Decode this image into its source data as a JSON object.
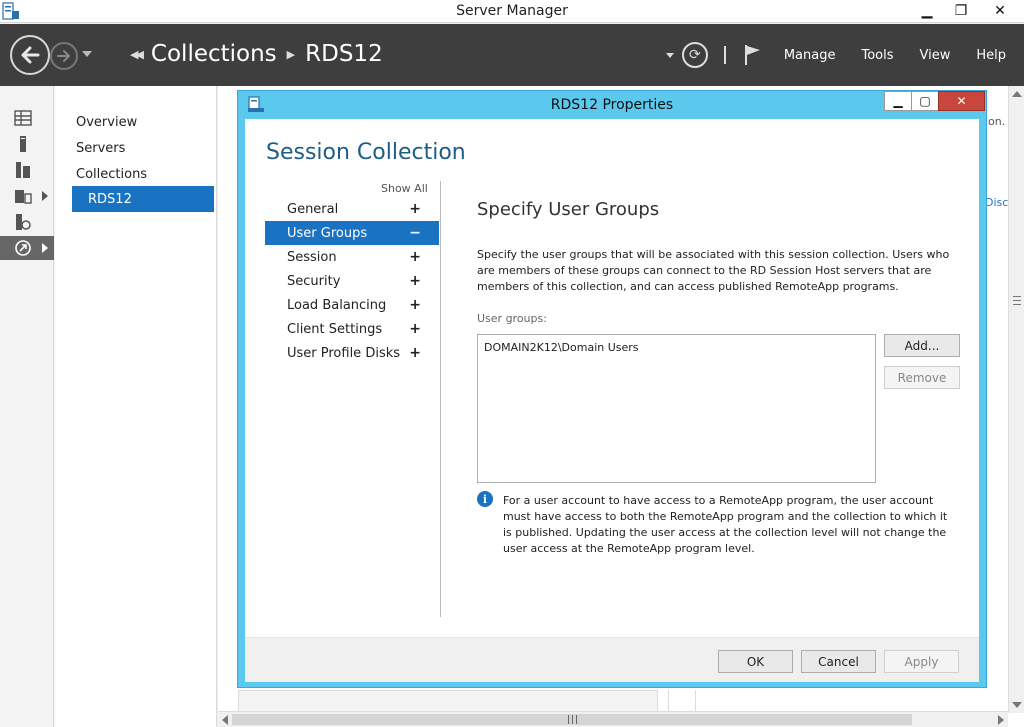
{
  "window": {
    "title": "Server Manager",
    "minimize": "▁",
    "restore": "❐",
    "close": "✕"
  },
  "toolbar": {
    "breadcrumb": [
      "Collections",
      "RDS12"
    ],
    "menus": [
      "Manage",
      "Tools",
      "View",
      "Help"
    ],
    "refresh_glyph": "⟳"
  },
  "rail": {
    "icons": [
      "dashboard-icon",
      "local-server-icon",
      "all-servers-icon",
      "file-storage-icon",
      "iis-icon",
      "remote-desktop-icon"
    ]
  },
  "navpane": {
    "items": [
      "Overview",
      "Servers",
      "Collections",
      "RDS12"
    ],
    "selected_index": 3
  },
  "background": {
    "frag1": "ion.",
    "frag2": "Disco"
  },
  "dialog": {
    "title": "RDS12 Properties",
    "minimize": "▁",
    "restore": "▢",
    "close": "✕",
    "heading": "Session Collection",
    "show_all": "Show All",
    "sidebar": [
      {
        "label": "General",
        "sign": "+"
      },
      {
        "label": "User Groups",
        "sign": "−"
      },
      {
        "label": "Session",
        "sign": "+"
      },
      {
        "label": "Security",
        "sign": "+"
      },
      {
        "label": "Load Balancing",
        "sign": "+"
      },
      {
        "label": "Client Settings",
        "sign": "+"
      },
      {
        "label": "User Profile Disks",
        "sign": "+"
      }
    ],
    "selected_index": 1,
    "section_title": "Specify User Groups",
    "description": "Specify the user groups that will be associated with this session collection. Users who are members of these groups can connect to the RD Session Host servers that are members of this collection, and can access published RemoteApp programs.",
    "groups_label": "User groups:",
    "groups": [
      "DOMAIN2K12\\Domain Users"
    ],
    "add_button": "Add...",
    "remove_button": "Remove",
    "info_glyph": "i",
    "info_text": "For a user account to have access to a RemoteApp program, the user account must have access to both the RemoteApp program and the collection to which it is published. Updating the user access at the collection level will not change the user access at the RemoteApp program level.",
    "ok_button": "OK",
    "cancel_button": "Cancel",
    "apply_button": "Apply"
  }
}
